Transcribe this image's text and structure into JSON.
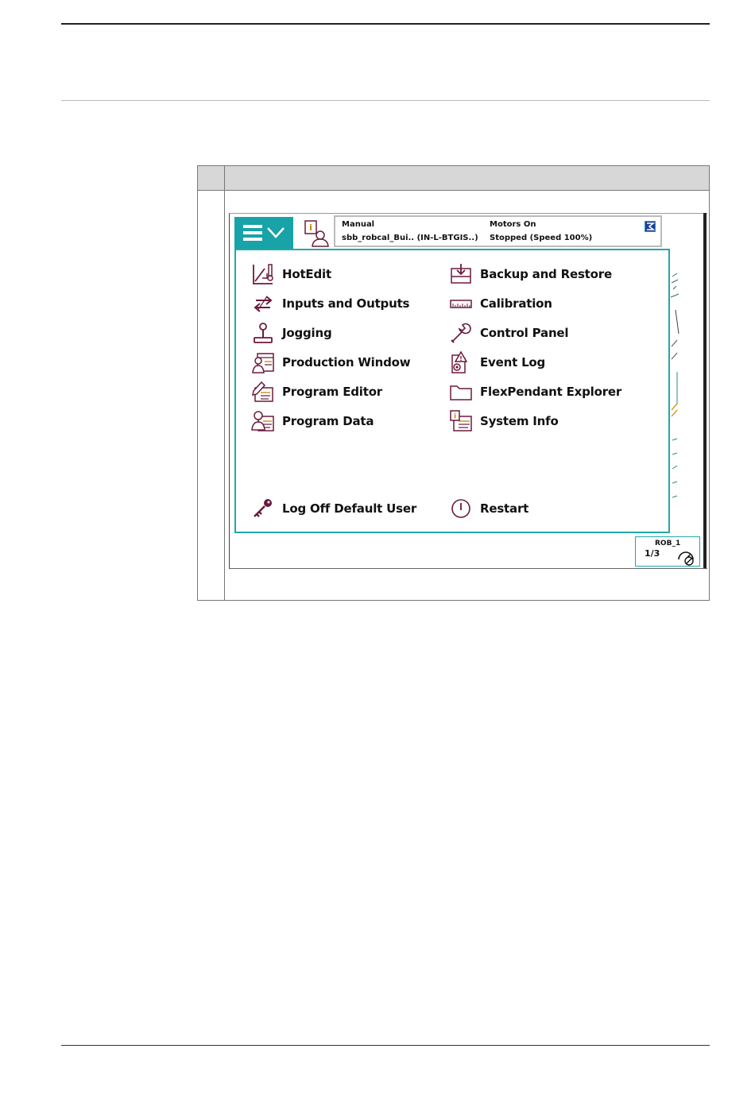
{
  "status": {
    "mode": "Manual",
    "system": "sbb_robcal_Bui.. (IN-L-BTGIS..)",
    "motors": "Motors On",
    "state": "Stopped (Speed 100%)"
  },
  "menu": {
    "left": [
      {
        "label": "HotEdit",
        "icon": "hotedit-icon"
      },
      {
        "label": "Inputs and Outputs",
        "icon": "io-arrows-icon"
      },
      {
        "label": "Jogging",
        "icon": "joystick-icon"
      },
      {
        "label": "Production Window",
        "icon": "production-window-icon"
      },
      {
        "label": "Program Editor",
        "icon": "program-editor-icon"
      },
      {
        "label": "Program Data",
        "icon": "program-data-icon"
      }
    ],
    "right": [
      {
        "label": "Backup and Restore",
        "icon": "backup-icon"
      },
      {
        "label": "Calibration",
        "icon": "ruler-icon"
      },
      {
        "label": "Control Panel",
        "icon": "wrench-icon"
      },
      {
        "label": "Event Log",
        "icon": "event-log-icon"
      },
      {
        "label": "FlexPendant Explorer",
        "icon": "folder-icon"
      },
      {
        "label": "System Info",
        "icon": "system-info-icon"
      }
    ],
    "log_off": {
      "label": "Log Off Default User",
      "icon": "key-icon"
    },
    "restart": {
      "label": "Restart",
      "icon": "power-icon"
    }
  },
  "robot": {
    "name": "ROB_1",
    "task_fraction": "1/3"
  },
  "colors": {
    "accent": "#17a3a7",
    "icon": "#6b1a3e"
  }
}
